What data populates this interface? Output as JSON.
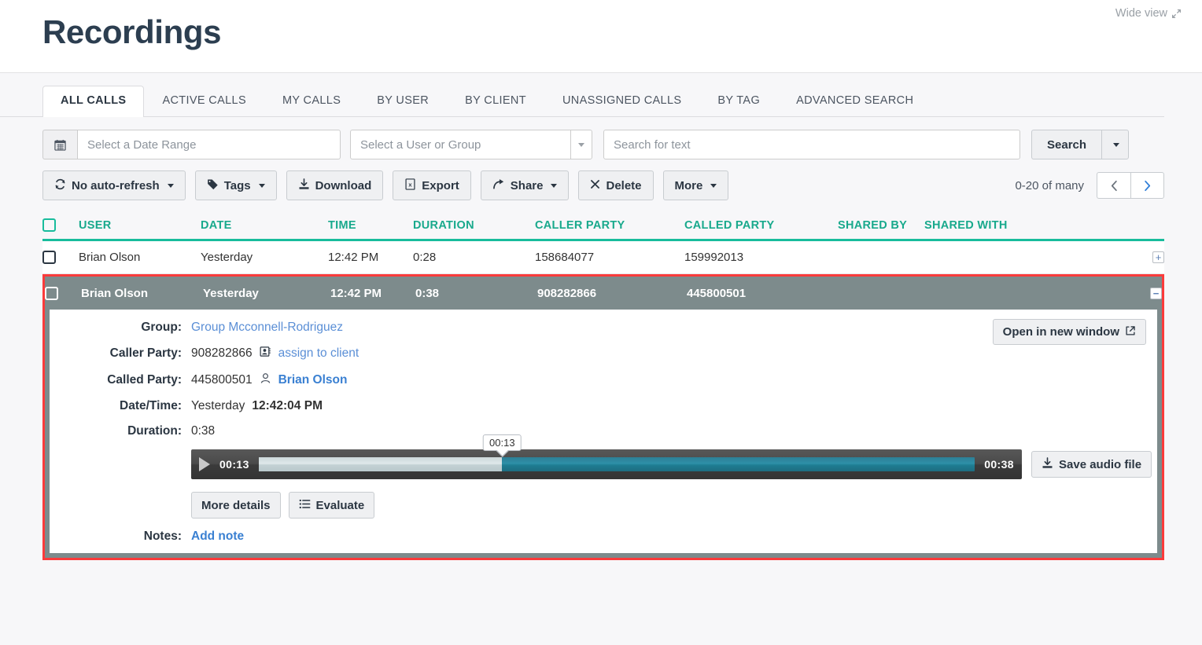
{
  "header": {
    "title": "Recordings",
    "wide_view_label": "Wide view"
  },
  "tabs": [
    {
      "label": "ALL CALLS",
      "active": true
    },
    {
      "label": "ACTIVE CALLS",
      "active": false
    },
    {
      "label": "MY CALLS",
      "active": false
    },
    {
      "label": "BY USER",
      "active": false
    },
    {
      "label": "BY CLIENT",
      "active": false
    },
    {
      "label": "UNASSIGNED CALLS",
      "active": false
    },
    {
      "label": "BY TAG",
      "active": false
    },
    {
      "label": "ADVANCED SEARCH",
      "active": false
    }
  ],
  "filters": {
    "date_range_placeholder": "Select a Date Range",
    "date_range_value": "",
    "user_group_placeholder": "Select a User or Group",
    "user_group_value": "",
    "search_text_placeholder": "Search for text",
    "search_text_value": "",
    "search_button": "Search"
  },
  "toolbar": {
    "auto_refresh": "No auto-refresh",
    "tags": "Tags",
    "download": "Download",
    "export": "Export",
    "share": "Share",
    "delete": "Delete",
    "more": "More",
    "pager_count": "0-20 of many"
  },
  "table": {
    "columns": [
      "USER",
      "DATE",
      "TIME",
      "DURATION",
      "CALLER PARTY",
      "CALLED PARTY",
      "SHARED BY",
      "SHARED WITH"
    ],
    "rows": [
      {
        "user": "Brian Olson",
        "date": "Yesterday",
        "time": "12:42 PM",
        "duration": "0:28",
        "caller_party": "158684077",
        "called_party": "159992013",
        "shared_by": "",
        "shared_with": "",
        "expanded": false,
        "expand_glyph": "+"
      },
      {
        "user": "Brian Olson",
        "date": "Yesterday",
        "time": "12:42 PM",
        "duration": "0:38",
        "caller_party": "908282866",
        "called_party": "445800501",
        "shared_by": "",
        "shared_with": "",
        "expanded": true,
        "expand_glyph": "−"
      }
    ]
  },
  "detail": {
    "open_in_new_window": "Open in new window",
    "labels": {
      "group": "Group:",
      "caller_party": "Caller Party:",
      "called_party": "Called Party:",
      "date_time": "Date/Time:",
      "duration": "Duration:",
      "notes": "Notes:"
    },
    "group_value": "Group Mcconnell-Rodriguez",
    "caller_party_value": "908282866",
    "assign_to_client": "assign to client",
    "called_party_value": "445800501",
    "called_party_user": "Brian Olson",
    "date_value": "Yesterday",
    "time_value": "12:42:04 PM",
    "duration_value": "0:38",
    "add_note": "Add note",
    "more_details": "More details",
    "evaluate": "Evaluate",
    "save_audio": "Save audio file"
  },
  "player": {
    "current_time": "00:13",
    "total_time": "00:38",
    "tooltip_time": "00:13",
    "progress_percent": 34,
    "tooltip_percent": 34
  },
  "colors": {
    "accent_teal": "#18bc9c",
    "selected_row_gray": "#7d8b8c",
    "highlight_red": "#fb3b3b",
    "link_blue": "#5b8fd6",
    "title_navy": "#2c3e50"
  }
}
